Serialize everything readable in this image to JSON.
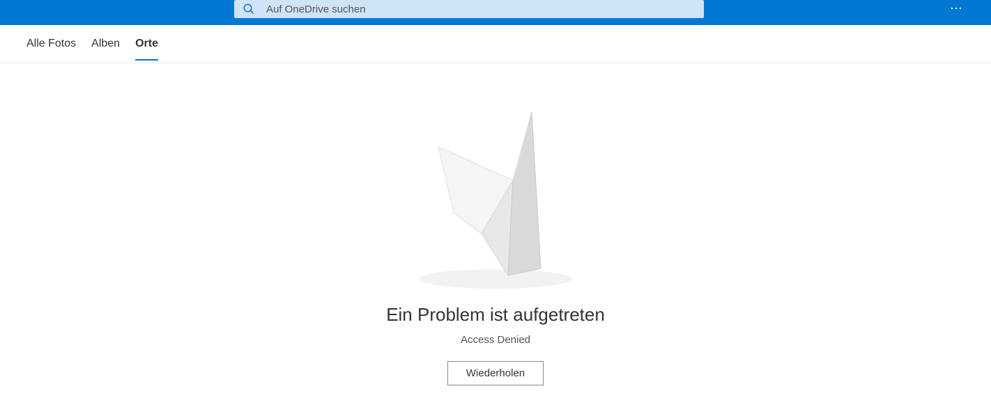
{
  "header": {
    "search_placeholder": "Auf OneDrive suchen"
  },
  "tabs": {
    "items": [
      {
        "label": "Alle Fotos"
      },
      {
        "label": "Alben"
      },
      {
        "label": "Orte"
      }
    ],
    "active_index": 2
  },
  "error": {
    "title": "Ein Problem ist aufgetreten",
    "message": "Access Denied",
    "retry_label": "Wiederholen"
  }
}
